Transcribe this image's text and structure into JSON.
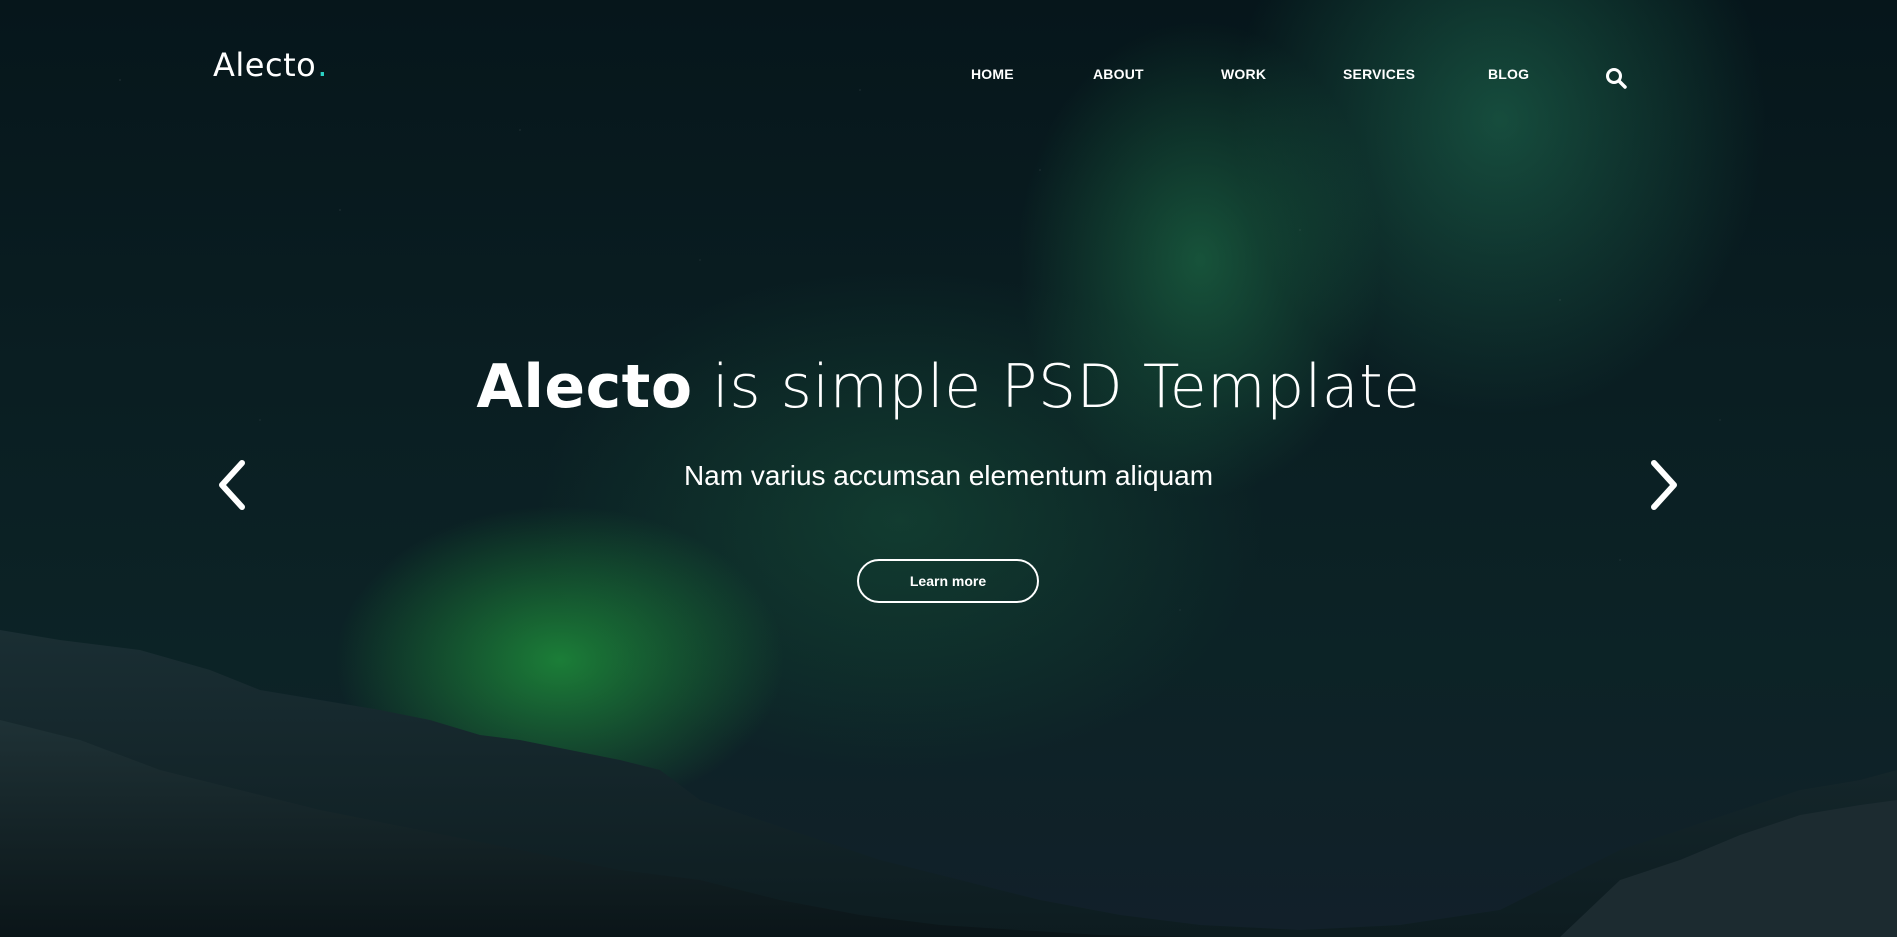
{
  "brand": {
    "name": "Alecto",
    "dot": ".",
    "accent_color": "#2bd1c4"
  },
  "nav": {
    "items": [
      {
        "label": "HOME"
      },
      {
        "label": "ABOUT"
      },
      {
        "label": "WORK"
      },
      {
        "label": "SERVICES"
      },
      {
        "label": "BLOG"
      }
    ],
    "search_icon": "search-icon"
  },
  "hero": {
    "title_bold": "Alecto",
    "title_rest": " is simple PSD Template",
    "subtitle": "Nam varius accumsan elementum aliquam",
    "cta_label": "Learn more",
    "prev_icon": "chevron-left-icon",
    "next_icon": "chevron-right-icon"
  }
}
